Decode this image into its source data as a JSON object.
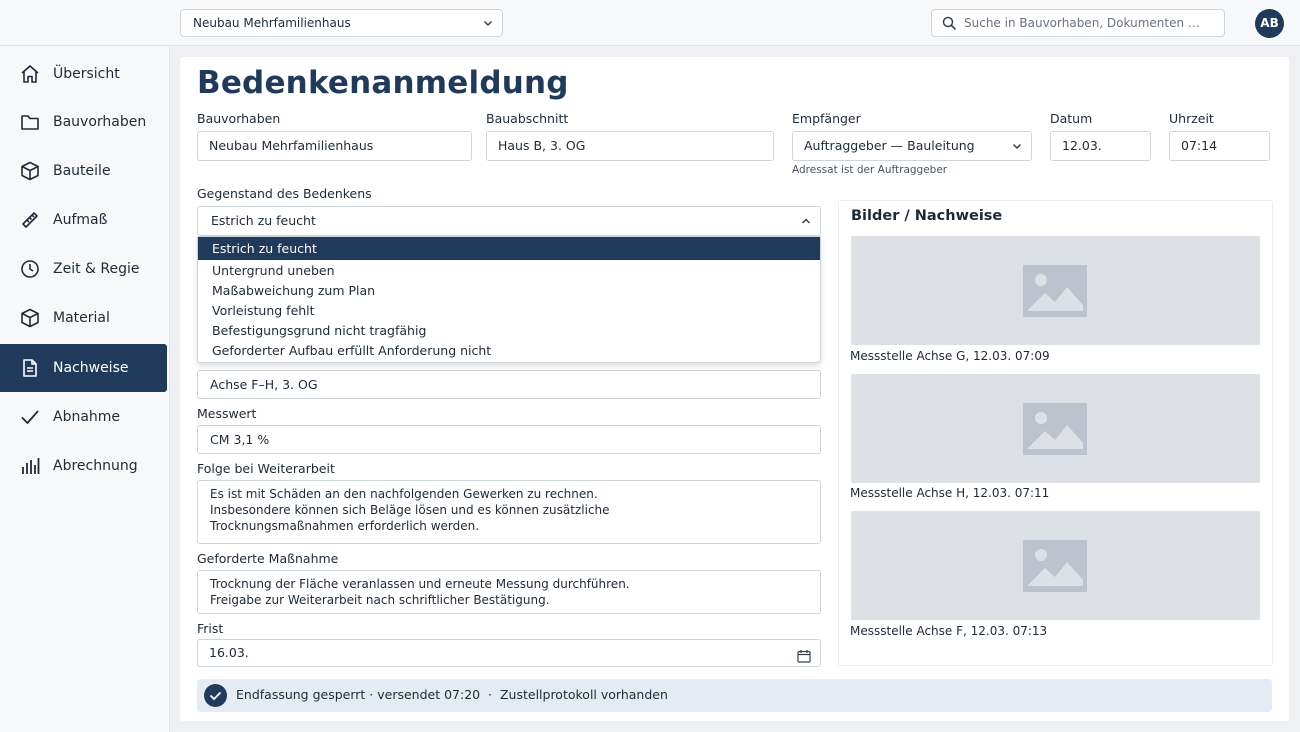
{
  "topbar": {
    "project": "Neubau Mehrfamilienhaus",
    "search_placeholder": "Suche in Bauvorhaben, Dokumenten …",
    "avatar": "AB"
  },
  "sidebar": {
    "items": [
      {
        "label": "Übersicht",
        "icon": "home-icon"
      },
      {
        "label": "Bauvorhaben",
        "icon": "folder-icon"
      },
      {
        "label": "Bauteile",
        "icon": "cube-icon"
      },
      {
        "label": "Aufmaß",
        "icon": "ruler-icon"
      },
      {
        "label": "Zeit & Regie",
        "icon": "clock-icon"
      },
      {
        "label": "Material",
        "icon": "box-icon"
      },
      {
        "label": "Nachweise",
        "icon": "document-icon",
        "active": true
      },
      {
        "label": "Abnahme",
        "icon": "check-icon"
      },
      {
        "label": "Abrechnung",
        "icon": "bar-chart-icon"
      }
    ]
  },
  "form": {
    "title": "Bedenkenanmeldung",
    "bauvorhaben_label": "Bauvorhaben",
    "bauvorhaben_value": "Neubau Mehrfamilienhaus",
    "bauabschnitt_label": "Bauabschnitt",
    "bauabschnitt_value": "Haus B, 3. OG",
    "empfaenger_label": "Empfänger",
    "empfaenger_value": "Auftraggeber — Bauleitung",
    "empfaenger_hint": "Adressat ist der Auftraggeber",
    "datum_label": "Datum",
    "datum_value": "12.03.",
    "uhrzeit_label": "Uhrzeit",
    "uhrzeit_value": "07:14",
    "gegenstand_label": "Gegenstand des Bedenkens",
    "gegenstand_value": "Estrich zu feucht",
    "gegenstand_options": [
      "Estrich zu feucht",
      "Untergrund uneben",
      "Maßabweichung zum Plan",
      "Vorleistung fehlt",
      "Befestigungsgrund nicht tragfähig",
      "Geforderter Aufbau erfüllt Anforderung nicht"
    ],
    "ort_value": "Achse F–H, 3. OG",
    "messwert_label": "Messwert",
    "messwert_value": "CM 3,1 %",
    "folge_label": "Folge bei Weiterarbeit",
    "folge_lines": [
      "Es ist mit Schäden an den nachfolgenden Gewerken zu rechnen.",
      "Insbesondere können sich Beläge lösen und es können zusätzliche",
      "Trocknungsmaßnahmen erforderlich werden."
    ],
    "massnahme_label": "Geforderte Maßnahme",
    "massnahme_lines": [
      "Trocknung der Fläche veranlassen und erneute Messung durchführen.",
      "Freigabe zur Weiterarbeit nach schriftlicher Bestätigung."
    ],
    "frist_label": "Frist",
    "frist_value": "16.03."
  },
  "images": {
    "title": "Bilder / Nachweise",
    "items": [
      {
        "caption": "Messstelle Achse G, 12.03. 07:09"
      },
      {
        "caption": "Messstelle Achse H, 12.03. 07:11"
      },
      {
        "caption": "Messstelle Achse F, 12.03. 07:13"
      }
    ]
  },
  "status": {
    "text": "Endfassung gesperrt · versendet 07:20  ·  Zustellprotokoll vorhanden"
  },
  "colors": {
    "accent": "#1f3a5a",
    "placeholder_bg": "#dde1e6",
    "status_bg": "#e4ebf2"
  }
}
